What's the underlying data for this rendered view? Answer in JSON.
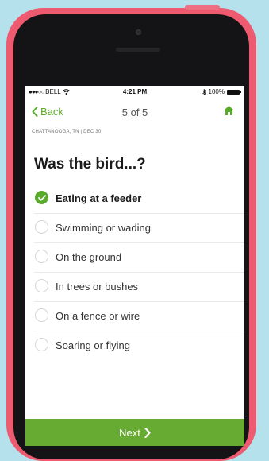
{
  "status_bar": {
    "carrier": "BELL",
    "time": "4:21 PM",
    "battery": "100%"
  },
  "nav": {
    "back_label": "Back",
    "page_indicator": "5 of 5"
  },
  "location_line": "CHATTANOOGA, TN  |  DEC 30",
  "question": "Was the bird...?",
  "options": [
    {
      "label": "Eating at a feeder",
      "selected": true
    },
    {
      "label": "Swimming or wading",
      "selected": false
    },
    {
      "label": "On the ground",
      "selected": false
    },
    {
      "label": "In trees or bushes",
      "selected": false
    },
    {
      "label": "On a fence or wire",
      "selected": false
    },
    {
      "label": "Soaring or flying",
      "selected": false
    }
  ],
  "next_label": "Next",
  "colors": {
    "accent": "#5aaa2c",
    "next_bar": "#68ab33",
    "case": "#ee5a6f",
    "background": "#b5e1ec"
  },
  "icons": [
    "wifi-icon",
    "bluetooth-icon",
    "battery-icon",
    "chevron-left-icon",
    "home-icon",
    "check-icon",
    "chevron-right-icon"
  ]
}
